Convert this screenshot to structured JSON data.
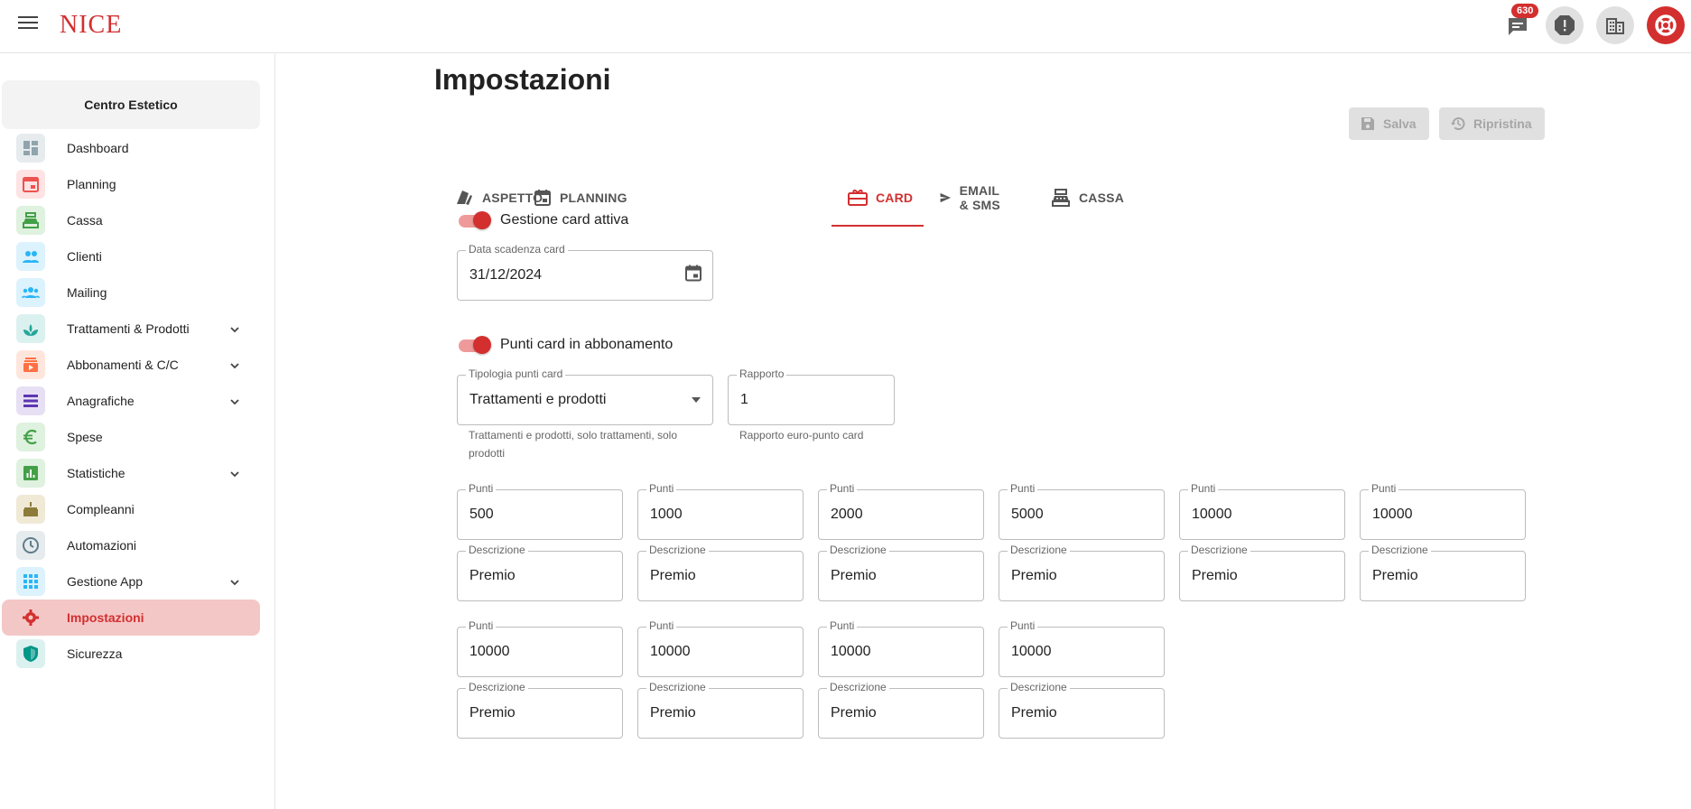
{
  "app": {
    "logo": "NICE",
    "notifications_count": "630"
  },
  "sidebar": {
    "center": "Centro Estetico",
    "items": [
      {
        "label": "Dashboard",
        "icon": "dashboard-icon",
        "color": "#90a4ae",
        "bg": "#e6ebee",
        "expandable": false
      },
      {
        "label": "Planning",
        "icon": "calendar-icon",
        "color": "#ef5350",
        "bg": "#fde3e3",
        "expandable": false
      },
      {
        "label": "Cassa",
        "icon": "cash-register-icon",
        "color": "#43a047",
        "bg": "#dff1df",
        "expandable": false
      },
      {
        "label": "Clienti",
        "icon": "people-icon",
        "color": "#29b6f6",
        "bg": "#dcf2fd",
        "expandable": false
      },
      {
        "label": "Mailing",
        "icon": "groups-icon",
        "color": "#29b6f6",
        "bg": "#dcf2fd",
        "expandable": false
      },
      {
        "label": "Trattamenti & Prodotti",
        "icon": "spa-icon",
        "color": "#26a69a",
        "bg": "#dbf1ef",
        "expandable": true
      },
      {
        "label": "Abbonamenti & C/C",
        "icon": "subscriptions-icon",
        "color": "#ff7043",
        "bg": "#ffe6dd",
        "expandable": true
      },
      {
        "label": "Anagrafiche",
        "icon": "list-icon",
        "color": "#5e35b1",
        "bg": "#e7e0f4",
        "expandable": true
      },
      {
        "label": "Spese",
        "icon": "euro-icon",
        "color": "#43a047",
        "bg": "#dff1df",
        "expandable": false
      },
      {
        "label": "Statistiche",
        "icon": "chart-icon",
        "color": "#43a047",
        "bg": "#dff1df",
        "expandable": true
      },
      {
        "label": "Compleanni",
        "icon": "cake-icon",
        "color": "#8d7b3a",
        "bg": "#efe9d6",
        "expandable": false
      },
      {
        "label": "Automazioni",
        "icon": "clock-icon",
        "color": "#607d8b",
        "bg": "#e6ebee",
        "expandable": false
      },
      {
        "label": "Gestione App",
        "icon": "apps-icon",
        "color": "#29b6f6",
        "bg": "#dcf2fd",
        "expandable": true
      },
      {
        "label": "Impostazioni",
        "icon": "gear-icon",
        "color": "#d32f2f",
        "bg": "transparent",
        "expandable": false,
        "active": true
      },
      {
        "label": "Sicurezza",
        "icon": "shield-icon",
        "color": "#009688",
        "bg": "#dbf1ef",
        "expandable": false
      }
    ]
  },
  "page": {
    "title": "Impostazioni",
    "save_label": "Salva",
    "reset_label": "Ripristina"
  },
  "tabs": [
    {
      "label": "ASPETTO",
      "icon": "palette-icon"
    },
    {
      "label": "PLANNING",
      "icon": "calendar-icon"
    },
    {
      "label": "CARD",
      "icon": "gift-card-icon",
      "active": true
    },
    {
      "label": "EMAIL & SMS",
      "icon": "send-icon"
    },
    {
      "label": "CASSA",
      "icon": "cash-register-icon"
    }
  ],
  "card": {
    "gestione_label": "Gestione card attiva",
    "scadenza_label": "Data scadenza card",
    "scadenza_value": "31/12/2024",
    "abbonamento_label": "Punti card in abbonamento",
    "tipologia_label": "Tipologia punti card",
    "tipologia_value": "Trattamenti e prodotti",
    "tipologia_helper": "Trattamenti e prodotti, solo trattamenti, solo prodotti",
    "rapporto_label": "Rapporto",
    "rapporto_value": "1",
    "rapporto_helper": "Rapporto euro-punto card",
    "punti_label": "Punti",
    "descrizione_label": "Descrizione",
    "premi": [
      {
        "punti": "500",
        "descrizione": "Premio"
      },
      {
        "punti": "1000",
        "descrizione": "Premio"
      },
      {
        "punti": "2000",
        "descrizione": "Premio"
      },
      {
        "punti": "5000",
        "descrizione": "Premio"
      },
      {
        "punti": "10000",
        "descrizione": "Premio"
      },
      {
        "punti": "10000",
        "descrizione": "Premio"
      },
      {
        "punti": "10000",
        "descrizione": "Premio"
      },
      {
        "punti": "10000",
        "descrizione": "Premio"
      },
      {
        "punti": "10000",
        "descrizione": "Premio"
      },
      {
        "punti": "10000",
        "descrizione": "Premio"
      }
    ]
  }
}
